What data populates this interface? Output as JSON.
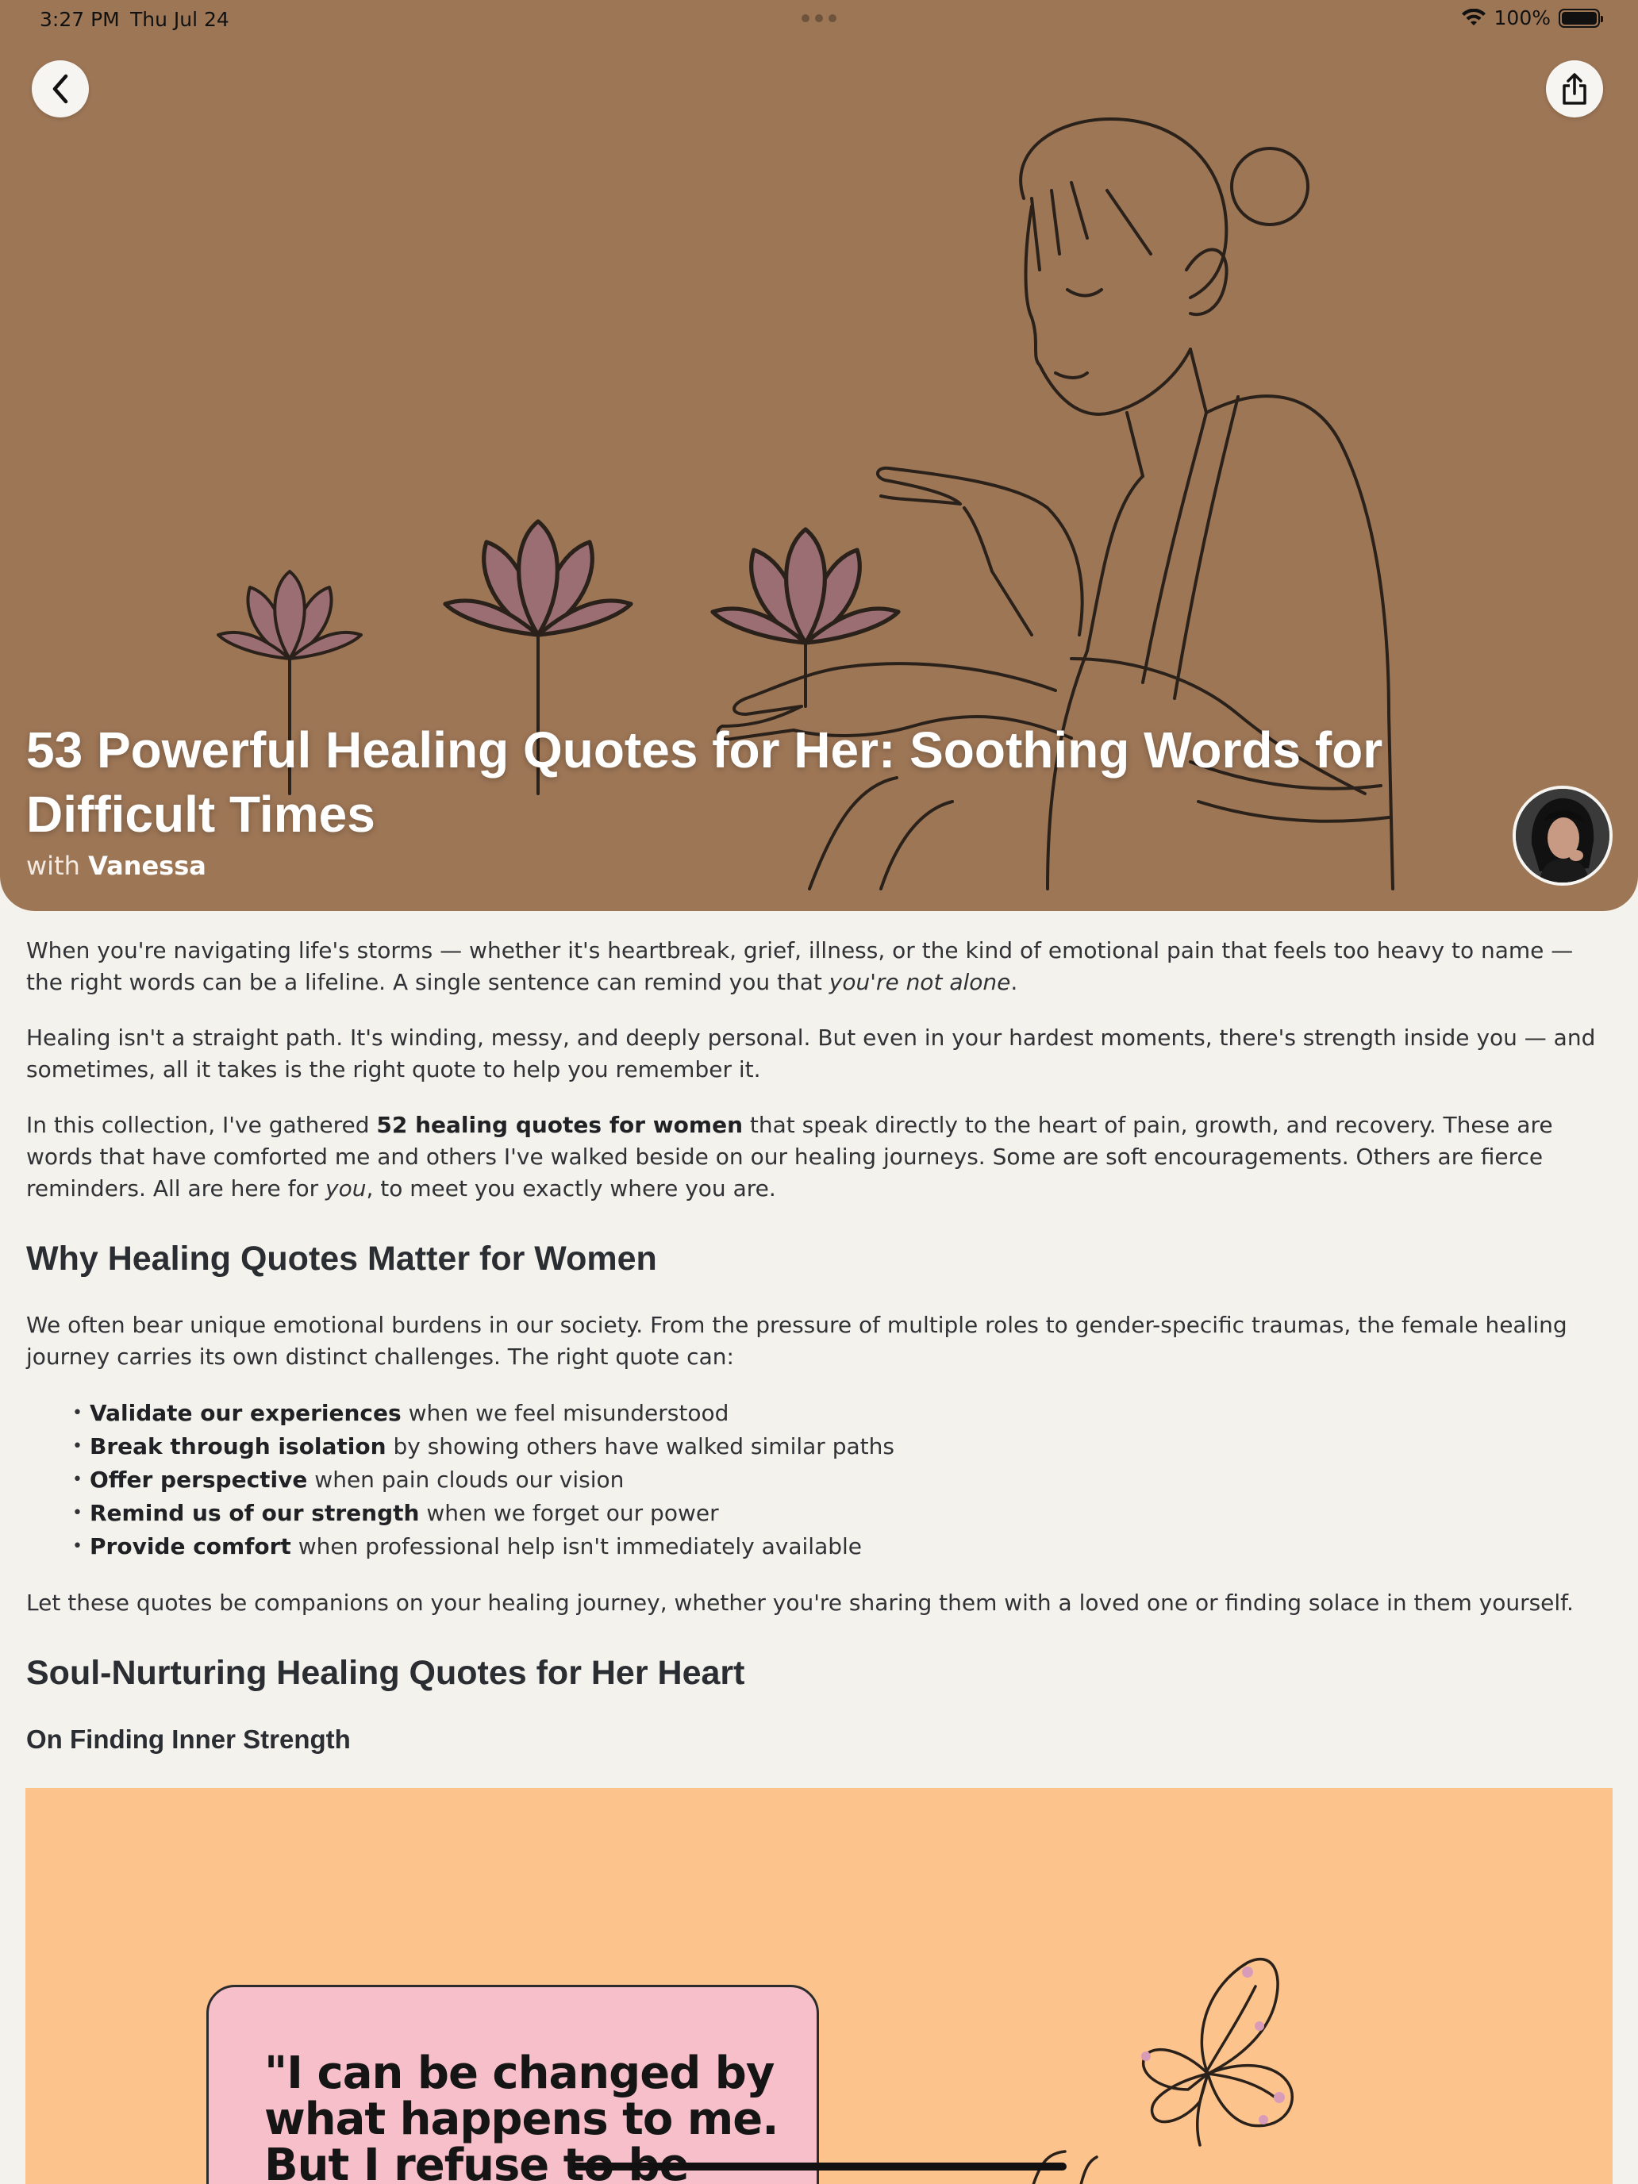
{
  "status_bar": {
    "time": "3:27 PM",
    "date": "Thu Jul 24",
    "battery": "100%",
    "battery_level": 1.0
  },
  "hero": {
    "title": "53 Powerful Healing Quotes for Her: Soothing Words for Difficult Times",
    "byline_prefix": "with",
    "author": "Vanessa",
    "background_color": "#9d7656"
  },
  "article": {
    "p1_a": "When you're navigating life's storms — whether it's heartbreak, grief, illness, or the kind of emotional pain that feels too heavy to name — the right words can be a lifeline. A single sentence can remind you that ",
    "p1_em": "you're not alone",
    "p1_b": ".",
    "p2": "Healing isn't a straight path. It's winding, messy, and deeply personal. But even in your hardest moments, there's strength inside you — and sometimes, all it takes is the right quote to help you remember it.",
    "p3_a": "In this collection, I've gathered ",
    "p3_bold": "52 healing quotes for women",
    "p3_b": " that speak directly to the heart of pain, growth, and recovery. These are words that have comforted me and others I've walked beside on our healing journeys. Some are soft encouragements. Others are fierce reminders. All are here for ",
    "p3_em": "you",
    "p3_c": ", to meet you exactly where you are.",
    "h2_why": "Why Healing Quotes Matter for Women",
    "p4": "We often bear unique emotional burdens in our society. From the pressure of multiple roles to gender-specific traumas, the female healing journey carries its own distinct challenges. The right quote can:",
    "bullets": [
      {
        "bold": "Validate our experiences",
        "rest": " when we feel misunderstood"
      },
      {
        "bold": "Break through isolation",
        "rest": " by showing others have walked similar paths"
      },
      {
        "bold": "Offer perspective",
        "rest": " when pain clouds our vision"
      },
      {
        "bold": "Remind us of our strength",
        "rest": " when we forget our power"
      },
      {
        "bold": "Provide comfort",
        "rest": " when professional help isn't immediately available"
      }
    ],
    "p5": "Let these quotes be companions on your healing journey, whether you're sharing them with a loved one or finding solace in them yourself.",
    "h2_soul": "Soul-Nurturing Healing Quotes for Her Heart",
    "h3_strength": "On Finding Inner Strength"
  },
  "quote_card": {
    "line1": "\"I can be changed by",
    "line2": "what happens to me.",
    "line3": "But I refuse to be",
    "background_color": "#fdc38d",
    "box_color": "#f7bfc9"
  },
  "icons": {
    "back": "chevron-left-icon",
    "share": "share-icon",
    "wifi": "wifi-icon",
    "battery": "battery-icon"
  }
}
